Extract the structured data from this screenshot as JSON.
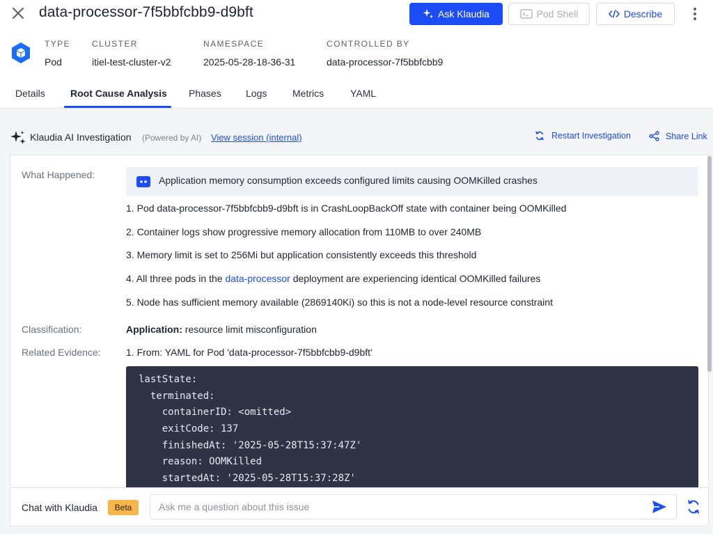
{
  "header": {
    "title": "data-processor-7f5bbfcbb9-d9bft",
    "ask_label": "Ask Klaudia",
    "shell_label": "Pod Shell",
    "describe_label": "Describe"
  },
  "meta": {
    "type_label": "TYPE",
    "type_value": "Pod",
    "cluster_label": "CLUSTER",
    "cluster_value": "itiel-test-cluster-v2",
    "namespace_label": "NAMESPACE",
    "namespace_value": "2025-05-28-18-36-31",
    "controlled_label": "CONTROLLED BY",
    "controlled_value": "data-processor-7f5bbfcbb9"
  },
  "tabs": [
    {
      "label": "Details"
    },
    {
      "label": "Root Cause Analysis",
      "active": true
    },
    {
      "label": "Phases"
    },
    {
      "label": "Logs"
    },
    {
      "label": "Metrics"
    },
    {
      "label": "YAML"
    }
  ],
  "investigation": {
    "title": "Klaudia AI Investigation",
    "subtitle": "(Powered by AI)",
    "session_link": "View session (internal)",
    "restart_label": "Restart Investigation",
    "share_label": "Share Link"
  },
  "analysis": {
    "what_happened_label": "What Happened:",
    "summary": "Application memory consumption exceeds configured limits causing OOMKilled crashes",
    "steps": [
      "1. Pod data-processor-7f5bbfcbb9-d9bft is in CrashLoopBackOff state with container being OOMKilled",
      "2. Container logs show progressive memory allocation from 110MB to over 240MB",
      "3. Memory limit is set to 256Mi but application consistently exceeds this threshold"
    ],
    "step4_prefix": "4. All three pods in the ",
    "step4_link": "data-processor",
    "step4_suffix": " deployment are experiencing identical OOMKilled failures",
    "step5": "5. Node has sufficient memory available (2869140Ki) so this is not a node-level resource constraint",
    "classification_label": "Classification:",
    "classification_key": "Application:",
    "classification_value": " resource limit misconfiguration",
    "evidence_label": "Related Evidence:",
    "evidence_title": "1. From: YAML for Pod 'data-processor-7f5bbfcbb9-d9bft'",
    "code_lines": [
      "lastState:",
      "  terminated:",
      "    containerID: <omitted>",
      "    exitCode: 137",
      "    finishedAt: '2025-05-28T15:37:47Z'",
      "    reason: OOMKilled",
      "    startedAt: '2025-05-28T15:37:28Z'"
    ]
  },
  "chat": {
    "label": "Chat with Klaudia",
    "badge": "Beta",
    "placeholder": "Ask me a question about this issue"
  },
  "colors": {
    "accent": "#1b4cf5",
    "code_bg": "#2e3346",
    "beta_badge": "#f8b54a"
  }
}
